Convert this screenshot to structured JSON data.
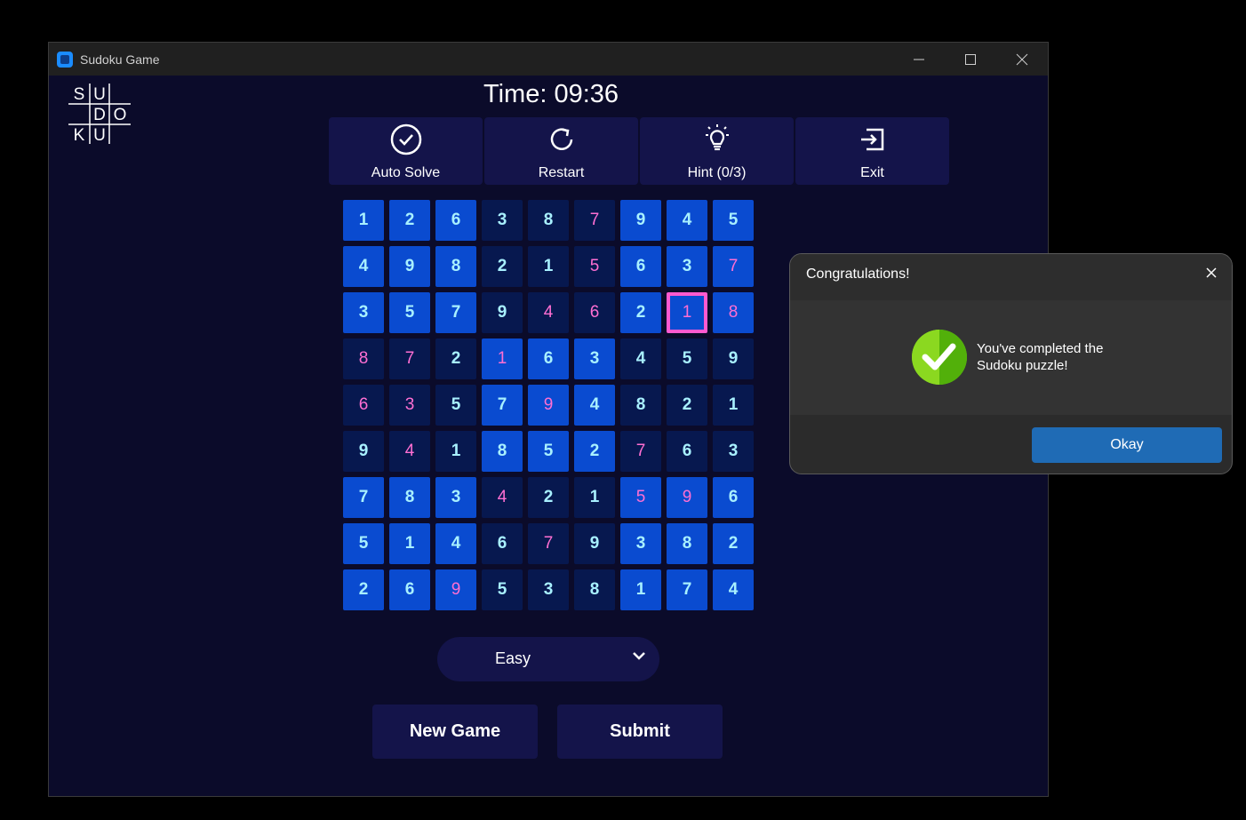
{
  "window": {
    "title": "Sudoku Game"
  },
  "logo": {
    "letters": [
      "S",
      "U",
      "D",
      "O",
      "K",
      "U"
    ]
  },
  "timer": {
    "text": "Time: 09:36"
  },
  "toolbar": [
    {
      "label": "Auto Solve",
      "icon": "check-circle-icon"
    },
    {
      "label": "Restart",
      "icon": "restart-icon"
    },
    {
      "label": "Hint (0/3)",
      "icon": "lightbulb-icon"
    },
    {
      "label": "Exit",
      "icon": "exit-icon"
    }
  ],
  "board": {
    "values": [
      [
        1,
        2,
        6,
        3,
        8,
        7,
        9,
        4,
        5
      ],
      [
        4,
        9,
        8,
        2,
        1,
        5,
        6,
        3,
        7
      ],
      [
        3,
        5,
        7,
        9,
        4,
        6,
        2,
        1,
        8
      ],
      [
        8,
        7,
        2,
        1,
        6,
        3,
        4,
        5,
        9
      ],
      [
        6,
        3,
        5,
        7,
        9,
        4,
        8,
        2,
        1
      ],
      [
        9,
        4,
        1,
        8,
        5,
        2,
        7,
        6,
        3
      ],
      [
        7,
        8,
        3,
        4,
        2,
        1,
        5,
        9,
        6
      ],
      [
        5,
        1,
        4,
        6,
        7,
        9,
        3,
        8,
        2
      ],
      [
        2,
        6,
        9,
        5,
        3,
        8,
        1,
        7,
        4
      ]
    ],
    "user_entered": [
      [
        0,
        0,
        0,
        0,
        0,
        1,
        0,
        0,
        0
      ],
      [
        0,
        0,
        0,
        0,
        0,
        1,
        0,
        0,
        1
      ],
      [
        0,
        0,
        0,
        0,
        1,
        1,
        0,
        1,
        1
      ],
      [
        1,
        1,
        0,
        1,
        0,
        0,
        0,
        0,
        0
      ],
      [
        1,
        1,
        0,
        0,
        1,
        0,
        0,
        0,
        0
      ],
      [
        0,
        1,
        0,
        0,
        0,
        0,
        1,
        0,
        0
      ],
      [
        0,
        0,
        0,
        1,
        0,
        0,
        1,
        1,
        0
      ],
      [
        0,
        0,
        0,
        0,
        1,
        0,
        0,
        0,
        0
      ],
      [
        0,
        0,
        1,
        0,
        0,
        0,
        0,
        0,
        0
      ]
    ],
    "selected": [
      2,
      7
    ],
    "colors": {
      "light_box": "#0a4bd0",
      "dark_box": "#07184f",
      "given_text": "#a8f0ff",
      "user_text": "#ff6fd3",
      "selected_border": "#ff5ad0"
    }
  },
  "difficulty": {
    "value": "Easy"
  },
  "buttons": {
    "new_game": "New Game",
    "submit": "Submit"
  },
  "dialog": {
    "title": "Congratulations!",
    "message": "You've completed the Sudoku puzzle!",
    "ok_label": "Okay"
  }
}
